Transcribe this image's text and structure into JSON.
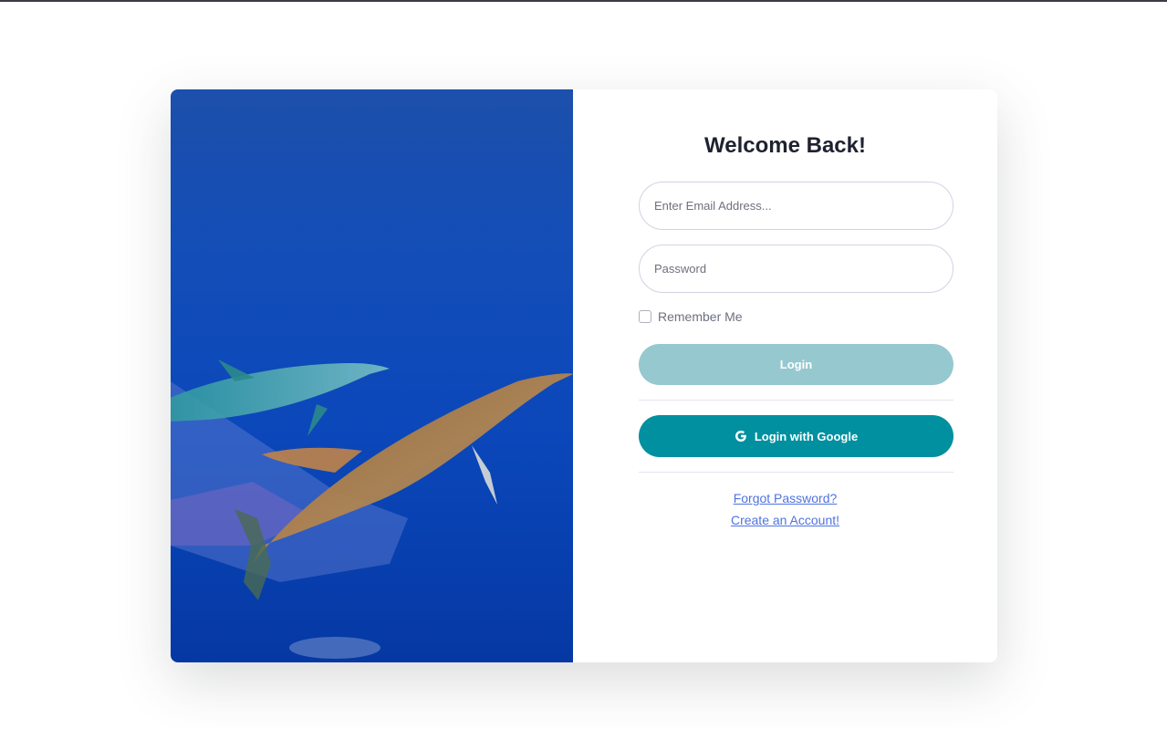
{
  "form": {
    "title": "Welcome Back!",
    "email_placeholder": "Enter Email Address...",
    "password_placeholder": "Password",
    "remember_label": "Remember Me",
    "remember_checked": false,
    "login_label": "Login",
    "google_label": "Login with Google",
    "forgot_link": "Forgot Password?",
    "create_link": "Create an Account!"
  },
  "image": {
    "subject": "dolphins-underwater-photo"
  },
  "colors": {
    "login_button": "#96c8cf",
    "google_button": "#00909f",
    "link": "#4e73df",
    "ocean": "#0a47b5"
  }
}
